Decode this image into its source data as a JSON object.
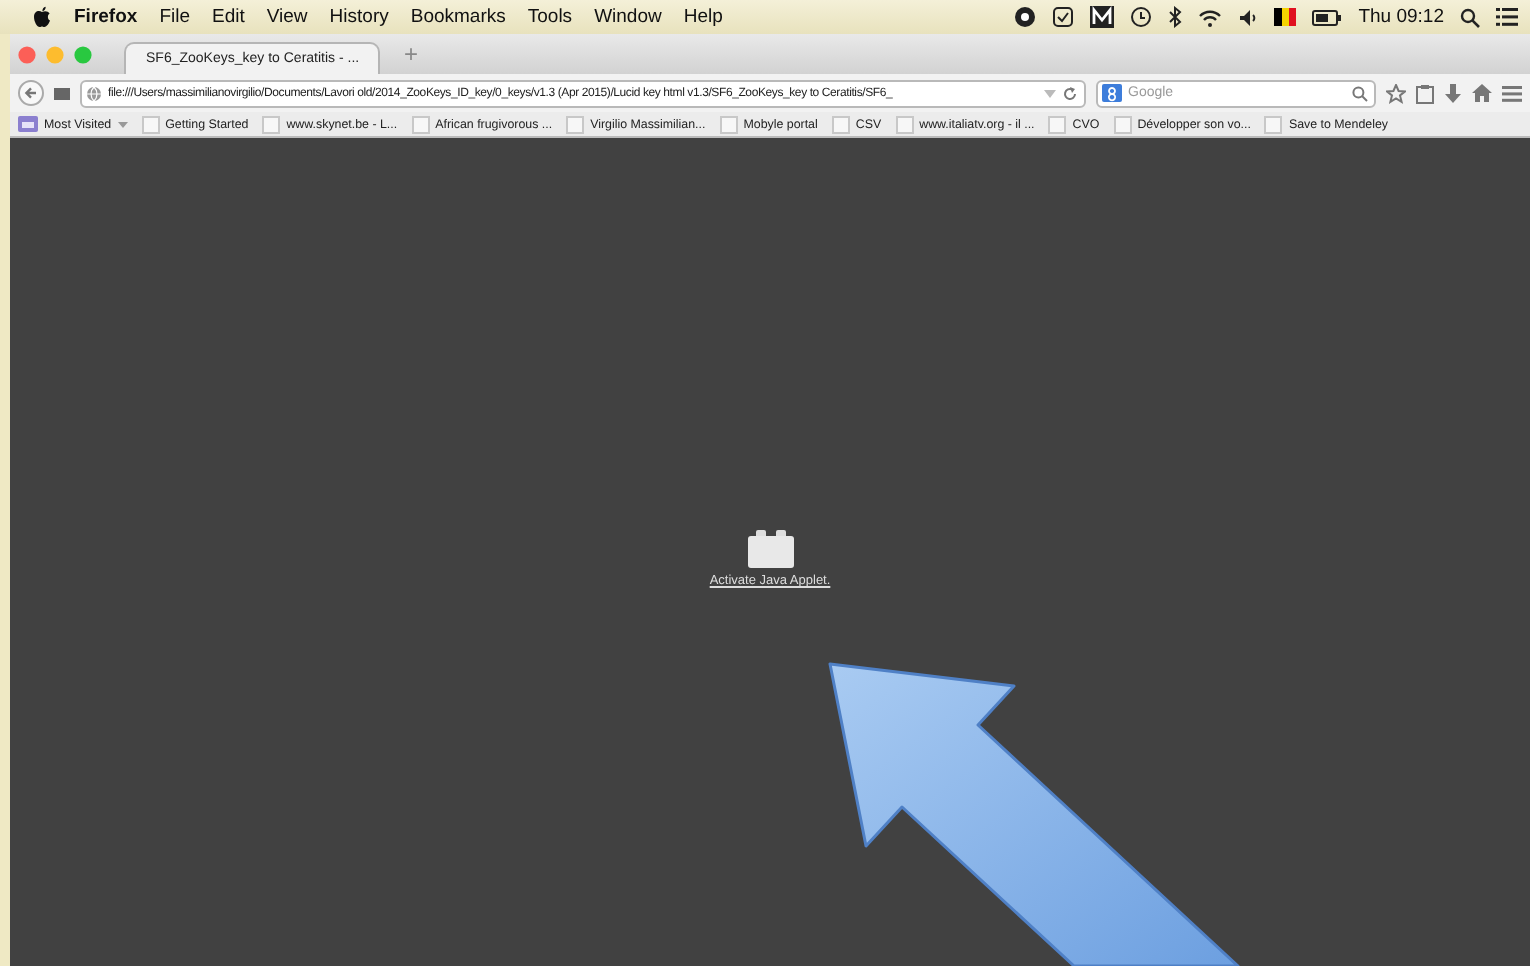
{
  "menu_bar": {
    "app": "Firefox",
    "items": [
      "File",
      "Edit",
      "View",
      "History",
      "Bookmarks",
      "Tools",
      "Window",
      "Help"
    ],
    "clock": "Thu 09:12"
  },
  "tabs": [
    {
      "label": "SF6_ZooKeys_key to Ceratitis - ...",
      "selected": true
    }
  ],
  "new_tab": "+",
  "address_bar": {
    "value": "file:///Users/massimilianovirgilio/Documents/Lavori old/2014_ZooKeys_ID_key/0_keys/v1.3 (Apr 2015)/Lucid key html v1.3/SF6_ZooKeys_key to Ceratitis/SF6_"
  },
  "search_field": {
    "placeholder": "Google"
  },
  "bookmarks": [
    {
      "label": "Most Visited",
      "kind": "folder"
    },
    {
      "label": "Getting Started",
      "kind": "page"
    },
    {
      "label": "www.skynet.be - L...",
      "kind": "page"
    },
    {
      "label": "African frugivorous ...",
      "kind": "page"
    },
    {
      "label": "Virgilio Massimilian...",
      "kind": "page"
    },
    {
      "label": "Mobyle portal",
      "kind": "page"
    },
    {
      "label": "CSV",
      "kind": "page"
    },
    {
      "label": "www.italiatv.org - il ...",
      "kind": "page"
    },
    {
      "label": "CVO",
      "kind": "page"
    },
    {
      "label": "Développer son vo...",
      "kind": "page"
    },
    {
      "label": "Save to Mendeley",
      "kind": "page"
    }
  ],
  "applet": {
    "label": "Activate Java Applet."
  }
}
